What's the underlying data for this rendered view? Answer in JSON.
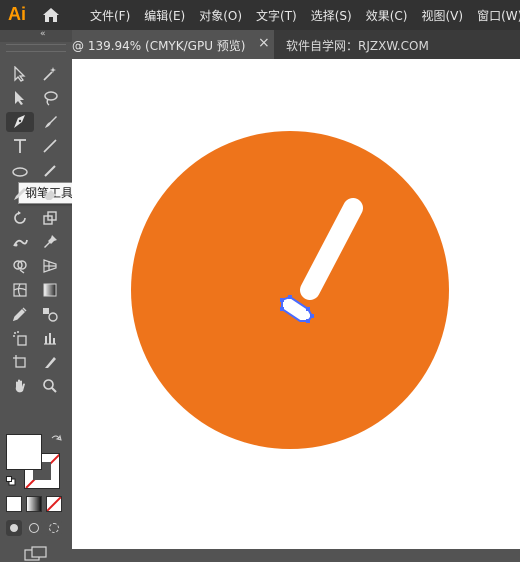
{
  "app": {
    "logo": "Ai"
  },
  "menu": [
    "文件(F)",
    "编辑(E)",
    "对象(O)",
    "文字(T)",
    "选择(S)",
    "效果(C)",
    "视图(V)",
    "窗口(W)"
  ],
  "tabs": {
    "active": {
      "label": "@ 139.94% (CMYK/GPU 预览)",
      "close": "×"
    },
    "inactive": {
      "label": "软件自学网：RJZXW.COM"
    }
  },
  "toolbox": {
    "header_collapse": "«",
    "tooltip": "钢笔工具 (P)",
    "tools": [
      [
        "selection-tool-icon",
        "direct-selection-tool-icon"
      ],
      [
        "group-selection-tool-icon",
        "magic-lasso-icon"
      ],
      [
        "pen-tool-icon",
        "curvature-tool-icon"
      ],
      [
        "type-tool-icon",
        "line-tool-icon"
      ],
      [
        "ellipse-tool-icon",
        "paintbrush-tool-icon"
      ],
      [
        "pencil-tool-icon",
        "eraser-tool-icon"
      ],
      [
        "rotate-tool-icon",
        "scale-tool-icon"
      ],
      [
        "puppet-warp-tool-icon",
        "pin-tool-icon"
      ],
      [
        "shape-builder-tool-icon",
        "perspective-grid-tool-icon"
      ],
      [
        "mesh-tool-icon",
        "gradient-tool-icon"
      ],
      [
        "eyedropper-tool-icon",
        "blend-tool-icon"
      ],
      [
        "symbol-sprayer-tool-icon",
        "graph-tool-icon"
      ],
      [
        "artboard-tool-icon",
        "slice-tool-icon"
      ],
      [
        "hand-tool-icon",
        "zoom-tool-icon"
      ]
    ]
  },
  "colors": {
    "circle_fill": "#EE741B",
    "hand_fill": "#FFFFFF",
    "selection": "#4A6BFF",
    "canvas_bg": "#FFFFFF"
  }
}
